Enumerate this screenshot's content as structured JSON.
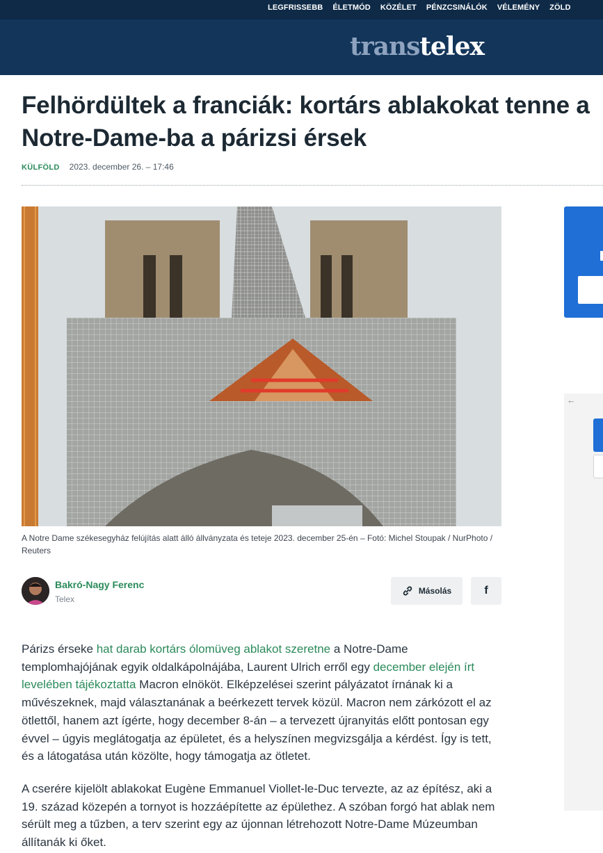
{
  "topnav": {
    "items": [
      "LEGFRISSEBB",
      "ÉLETMÓD",
      "KÖZÉLET",
      "PÉNZCSINÁLÓK",
      "VÉLEMÉNY",
      "ZÖLD"
    ]
  },
  "logo": {
    "part1": "trans",
    "part2": "telex"
  },
  "article": {
    "title": "Felhördültek a franciák: kortárs ablakokat tenne a Notre-Dame-ba a párizsi érsek",
    "category": "KÜLFÖLD",
    "date": "2023. december 26. – 17:46",
    "caption": "A Notre Dame székesegyház felújítás alatt álló állványzata és teteje 2023. december 25-én – Fotó: Michel Stoupak / NurPhoto / Reuters"
  },
  "author": {
    "name": "Bakró-Nagy Ferenc",
    "org": "Telex"
  },
  "share": {
    "copy_label": "Másolás",
    "facebook_label": "f"
  },
  "body": {
    "p1": {
      "t1": "Párizs érseke ",
      "link1": "hat darab kortárs ólomüveg ablakot szeretne",
      "t2": " a Notre-Dame templomhajójának egyik oldalkápolnájába, Laurent Ulrich erről egy ",
      "link2": "december elején írt levelében tájékoztatta",
      "t3": " Macron elnököt. Elképzelései szerint pályázatot írnának ki a művészeknek, majd választanának a beérkezett tervek közül. Macron nem zárkózott el az ötlettől, hanem azt ígérte, hogy december 8-án – a tervezett újranyitás előtt pontosan egy évvel – úgyis meglátogatja az épületet, és a helyszínen megvizsgálja a kérdést. Így is tett, és a látogatása után közölte, hogy támogatja az ötletet."
    },
    "p2": "A cserére kijelölt ablakokat Eugène Emmanuel Viollet-le-Duc tervezte, az az építész, aki a 19. század közepén a tornyot is hozzáépítette az épülethez. A szóban forgó hat ablak nem sérült meg a tűzben, a terv szerint egy az újonnan létrehozott Notre-Dame Múzeumban állítanák ki őket."
  },
  "sidebar": {
    "back_arrow": "←"
  },
  "colors": {
    "nav": "#0e2a47",
    "masthead": "#13355a",
    "accent_green": "#2b8a5a",
    "side_blue": "#1f6fd6"
  },
  "icons": [
    "link-icon",
    "facebook-icon",
    "back-arrow-icon"
  ]
}
